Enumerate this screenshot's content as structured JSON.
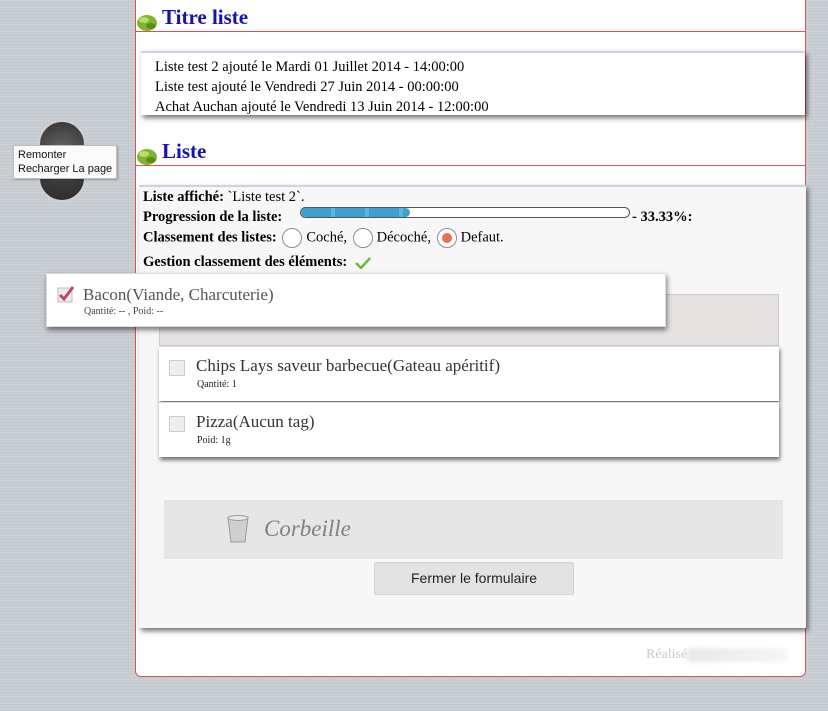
{
  "side_menu": {
    "scroll_up": "Remonter",
    "reload": "Recharger La page"
  },
  "titre_section": {
    "title": "Titre liste",
    "lines": [
      "Liste test 2 ajouté le Mardi 01 Juillet 2014 - 14:00:00",
      "Liste test ajouté le Vendredi 27 Juin 2014 - 00:00:00",
      "Achat Auchan ajouté le Vendredi 13 Juin 2014 - 12:00:00"
    ]
  },
  "liste_section": {
    "title": "Liste",
    "displayed_label": "Liste affiché:",
    "displayed_value": " `Liste test 2`.",
    "progress_label": "Progression de la liste:",
    "progress_text": " - 33.33%:",
    "progress_fraction": 0.3333,
    "sort_label": "Classement des listes:",
    "sort_options": [
      "Coché,",
      "Décoché,",
      "Defaut."
    ],
    "sort_selected": 2,
    "element_sort_label": "Gestion classement des éléments:"
  },
  "dragged_item": {
    "name": "Bacon(Viande, Charcuterie)",
    "sub": "Qantité: -- , Poid: --"
  },
  "items": [
    {
      "name": "Chips Lays saveur barbecue(Gateau apéritif)",
      "sub": "Qantité: 1"
    },
    {
      "name": "Pizza(Aucun tag)",
      "sub": "Poid: 1g"
    }
  ],
  "trash_label": "Corbeille",
  "close_button": "Fermer le formulaire",
  "footer_text": "Réalisé",
  "colors": {
    "title": "#1512b5",
    "border": "#d9545a",
    "progress": "#3fa0cf",
    "radio_on": "#ee6d52"
  }
}
